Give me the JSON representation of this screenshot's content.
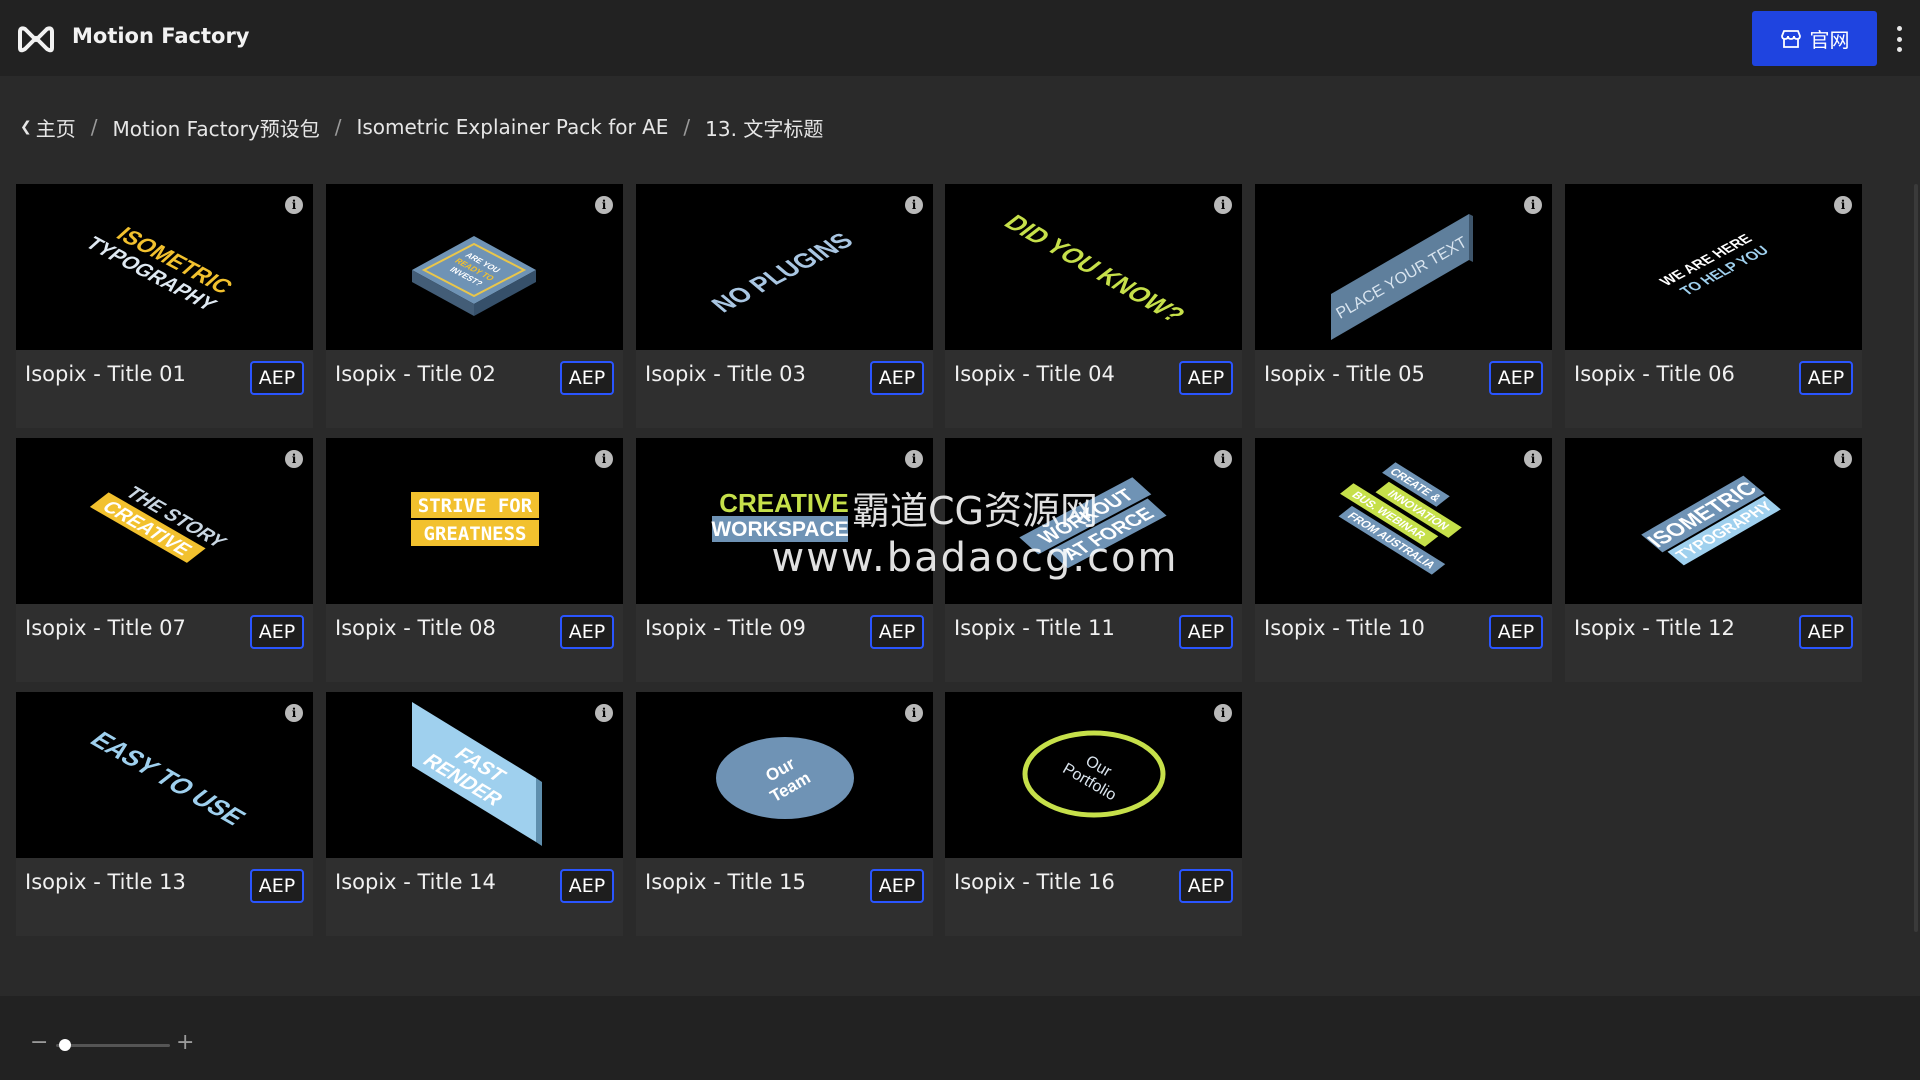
{
  "app": {
    "title": "Motion Factory"
  },
  "header": {
    "site_button_label": "官网"
  },
  "breadcrumb": [
    {
      "label": "主页"
    },
    {
      "label": "Motion Factory预设包"
    },
    {
      "label": "Isometric Explainer Pack for AE"
    },
    {
      "label": "13. 文字标题"
    }
  ],
  "cards": [
    {
      "title": "Isopix - Title 01",
      "badge": "AEP",
      "thumb_text": [
        "ISOMETRIC",
        "TYPOGRAPHY"
      ]
    },
    {
      "title": "Isopix - Title 02",
      "badge": "AEP",
      "thumb_text": [
        "ARE YOU",
        "READY TO",
        "INVEST?"
      ]
    },
    {
      "title": "Isopix - Title 03",
      "badge": "AEP",
      "thumb_text": [
        "NO PLUGINS"
      ]
    },
    {
      "title": "Isopix - Title 04",
      "badge": "AEP",
      "thumb_text": [
        "DID YOU KNOW?"
      ]
    },
    {
      "title": "Isopix - Title 05",
      "badge": "AEP",
      "thumb_text": [
        "PLACE YOUR TEXT"
      ]
    },
    {
      "title": "Isopix - Title 06",
      "badge": "AEP",
      "thumb_text": [
        "WE ARE HERE",
        "TO HELP YOU"
      ]
    },
    {
      "title": "Isopix - Title 07",
      "badge": "AEP",
      "thumb_text": [
        "THE STORY",
        "CREATIVE"
      ]
    },
    {
      "title": "Isopix - Title 08",
      "badge": "AEP",
      "thumb_text": [
        "STRIVE FOR",
        "GREATNESS"
      ]
    },
    {
      "title": "Isopix - Title 09",
      "badge": "AEP",
      "thumb_text": [
        "CREATIVE",
        "WORKSPACE"
      ]
    },
    {
      "title": "Isopix - Title 11",
      "badge": "AEP",
      "thumb_text": [
        "WORKOUT",
        "AT FORCE"
      ]
    },
    {
      "title": "Isopix - Title 10",
      "badge": "AEP",
      "thumb_text": [
        "CREATE &",
        "INNOVATION",
        "BUS. WEBINAR",
        "FROM AUSTRALIA"
      ]
    },
    {
      "title": "Isopix - Title 12",
      "badge": "AEP",
      "thumb_text": [
        "ISOMETRIC",
        "TYPOGRAPHY"
      ]
    },
    {
      "title": "Isopix - Title 13",
      "badge": "AEP",
      "thumb_text": [
        "EASY TO USE"
      ]
    },
    {
      "title": "Isopix - Title 14",
      "badge": "AEP",
      "thumb_text": [
        "FAST",
        "RENDER"
      ]
    },
    {
      "title": "Isopix - Title 15",
      "badge": "AEP",
      "thumb_text": [
        "Our",
        "Team"
      ]
    },
    {
      "title": "Isopix - Title 16",
      "badge": "AEP",
      "thumb_text": [
        "Our",
        "Portfolio"
      ]
    }
  ],
  "watermark": {
    "line1": "霸道CG资源网",
    "line2": "www.badaocg.com"
  },
  "zoom": {
    "minus": "−",
    "plus": "+",
    "level": 0.08
  },
  "colors": {
    "accent": "#1f44e0",
    "badge_border": "#2a55ff",
    "yellow": "#f2c12e",
    "green": "#c6e04a",
    "blue": "#9fd0ee",
    "steel": "#5f7f9c"
  },
  "icons": {
    "logo": "motion-factory-logo",
    "store": "store-icon",
    "info": "info-icon",
    "back": "chevron-left-icon",
    "menu": "kebab-menu-icon"
  }
}
